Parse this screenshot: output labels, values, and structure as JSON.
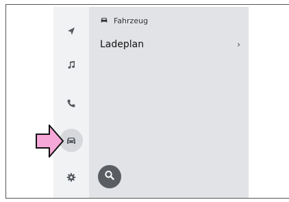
{
  "sidebar": {
    "items": [
      {
        "icon": "navigation-icon",
        "active": false
      },
      {
        "icon": "music-note-icon",
        "active": false
      },
      {
        "icon": "phone-icon",
        "active": false
      },
      {
        "icon": "car-icon",
        "active": true
      },
      {
        "icon": "gear-icon",
        "active": false
      }
    ]
  },
  "main": {
    "breadcrumb": {
      "icon": "car-icon",
      "label": "Fahrzeug"
    },
    "rows": [
      {
        "label": "Ladeplan",
        "chevron": "›"
      }
    ],
    "search_button": {
      "icon": "search-icon"
    }
  },
  "annotation": {
    "icon": "pointer-arrow-icon",
    "color": "#f6a8d8"
  },
  "colors": {
    "sidebar_bg": "#f1f2f4",
    "main_bg": "#e1e3e6",
    "active_item_bg": "#d6d8db",
    "fab_bg": "#5a5d62",
    "icon_color": "#555a60"
  }
}
